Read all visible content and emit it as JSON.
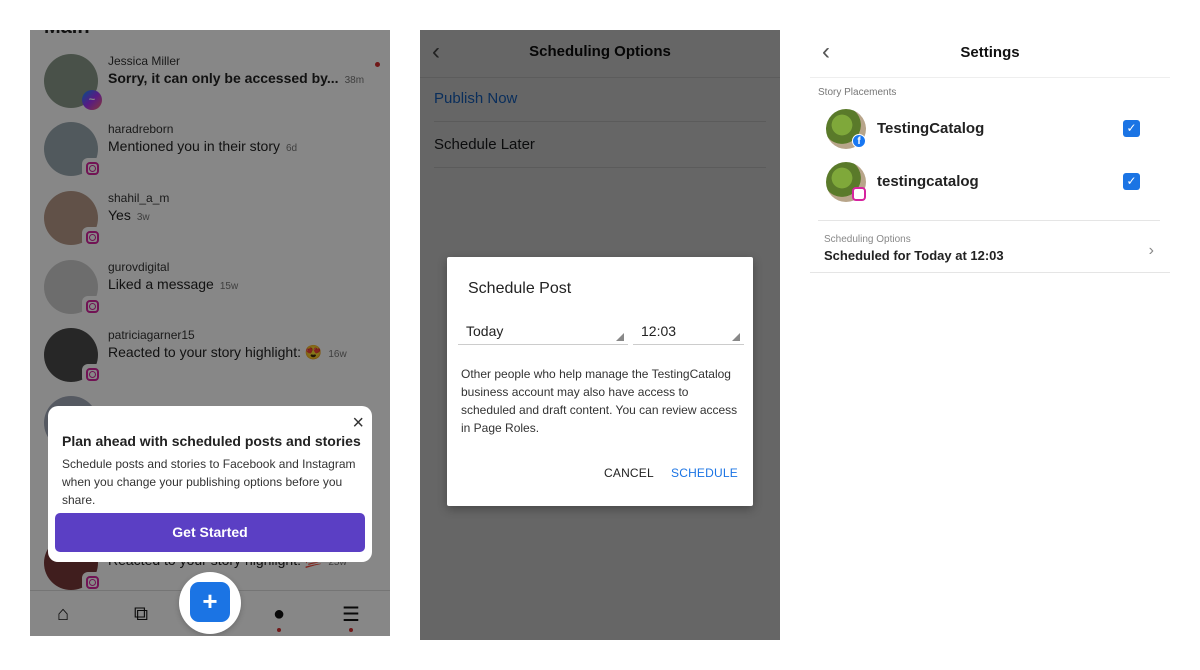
{
  "inbox": {
    "heading": "Main",
    "messages": [
      {
        "name": "Jessica Miller",
        "text": "Sorry, it can only be accessed by...",
        "time": "38m",
        "platform": "messenger",
        "unread": true,
        "avatar_color": "#8a9a8a"
      },
      {
        "name": "haradreborn",
        "text": "Mentioned you in their story",
        "time": "6d",
        "platform": "instagram",
        "unread": false,
        "avatar_color": "#9aa8b0"
      },
      {
        "name": "shahil_a_m",
        "text": "Yes",
        "time": "3w",
        "platform": "instagram",
        "unread": false,
        "avatar_color": "#b89a88"
      },
      {
        "name": "gurovdigital",
        "text": "Liked a message",
        "time": "15w",
        "platform": "instagram",
        "unread": false,
        "avatar_color": "#cfcfcf"
      },
      {
        "name": "patriciagarner15",
        "text": "Reacted to your story highlight: 😍",
        "time": "16w",
        "platform": "instagram",
        "unread": false,
        "avatar_color": "#4a4a4a"
      },
      {
        "name": "",
        "text": "",
        "time": "",
        "platform": "instagram",
        "unread": false,
        "avatar_color": "#a0a8b8"
      },
      {
        "name": "",
        "text": "Reacted to your story highlight: 💯",
        "time": "25w",
        "platform": "instagram",
        "unread": false,
        "avatar_color": "#7a3a3a"
      }
    ],
    "popup": {
      "title": "Plan ahead with scheduled posts and stories",
      "body": "Schedule posts and stories to Facebook and Instagram when you change your publishing options before you share.",
      "button": "Get Started",
      "close_icon": "×",
      "button_color": "#5b3fc4"
    },
    "nav": {
      "home_icon": "⌂",
      "pages_icon": "⧉",
      "create_icon": "+",
      "inbox_icon": "●",
      "menu_icon": "☰"
    }
  },
  "scheduling": {
    "title": "Scheduling Options",
    "back_icon": "‹",
    "options": [
      "Publish Now",
      "Schedule Later"
    ],
    "dialog": {
      "title": "Schedule Post",
      "date_value": "Today",
      "time_value": "12:03",
      "body": "Other people who help manage the TestingCatalog business account may also have access to scheduled and draft content. You can review access in Page Roles.",
      "cancel": "CANCEL",
      "schedule": "SCHEDULE"
    }
  },
  "settings": {
    "title": "Settings",
    "back_icon": "‹",
    "section_label": "Story Placements",
    "accounts": [
      {
        "name": "TestingCatalog",
        "platform": "facebook",
        "badge": "f",
        "checked": true
      },
      {
        "name": "testingcatalog",
        "platform": "instagram",
        "badge": "",
        "checked": true
      }
    ],
    "scheduling_label": "Scheduling Options",
    "scheduling_value": "Scheduled for Today at 12:03",
    "chevron_icon": "›",
    "accent_color": "#1b74e4"
  }
}
